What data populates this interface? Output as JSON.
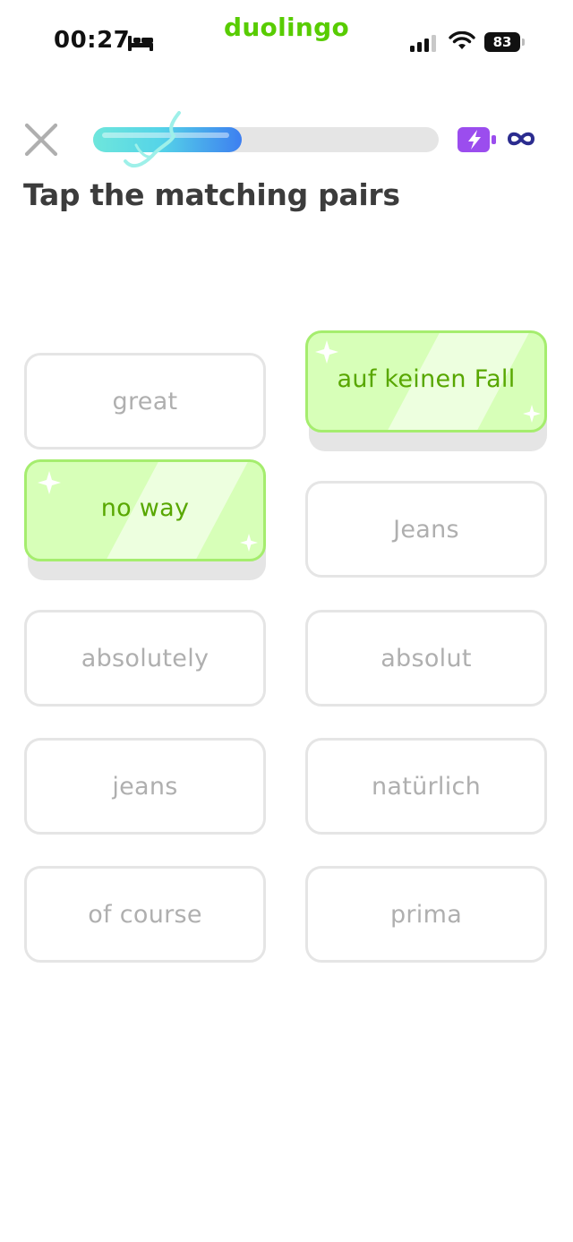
{
  "status_bar": {
    "time": "00:27",
    "battery_level": "83"
  },
  "brand": "duolingo",
  "lesson": {
    "progress_fraction": 0.43,
    "energy": "∞",
    "prompt": "Tap the matching pairs"
  },
  "tiles": {
    "great": "great",
    "auf_keinen_fall": "auf keinen Fall",
    "no_way": "no way",
    "Jeans_de": "Jeans",
    "absolutely": "absolutely",
    "absolut": "absolut",
    "jeans_en": "jeans",
    "naturlich": "natürlich",
    "of_course": "of course",
    "prima": "prima"
  },
  "colors": {
    "brand_green": "#58cc02",
    "matched_bg": "#d7ffb8",
    "matched_border": "#a5ed6e",
    "matched_text": "#58a700",
    "tile_border": "#e5e5e5",
    "tile_text": "#afafaf",
    "energy_purple": "#9b4dee",
    "infinity_navy": "#2b2c8f"
  },
  "icons": [
    "bed-icon",
    "signal-icon",
    "wifi-icon",
    "battery-icon",
    "close-icon",
    "energy-icon",
    "infinity-icon",
    "sparkle-icon"
  ]
}
